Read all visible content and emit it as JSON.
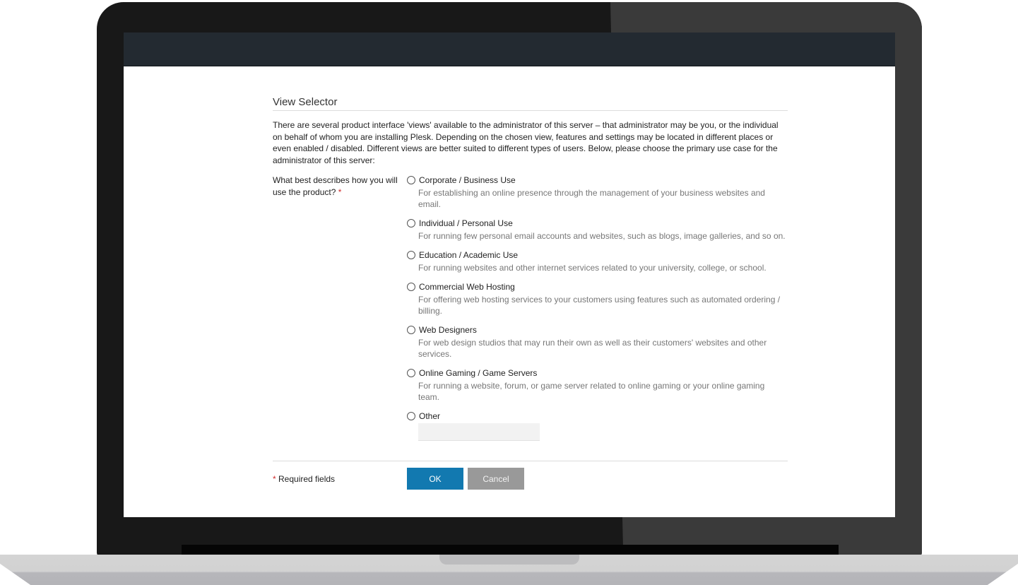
{
  "page": {
    "title": "View Selector",
    "intro": "There are several product interface 'views' available to the administrator of this server – that administrator may be you, or the individual on behalf of whom you are installing Plesk. Depending on the chosen view, features and settings may be located in different places or even enabled / disabled. Different views are better suited to different types of users. Below, please choose the primary use case for the administrator of this server:"
  },
  "form": {
    "question": "What best describes how you will use the product?",
    "required_marker": "*",
    "options": [
      {
        "label": "Corporate / Business Use",
        "description": "For establishing an online presence through the management of your business websites and email.",
        "selected": false
      },
      {
        "label": "Individual / Personal Use",
        "description": "For running few personal email accounts and websites, such as blogs, image galleries, and so on.",
        "selected": false
      },
      {
        "label": "Education / Academic Use",
        "description": "For running websites and other internet services related to your university, college, or school.",
        "selected": false
      },
      {
        "label": "Commercial Web Hosting",
        "description": "For offering web hosting services to your customers using features such as automated ordering / billing.",
        "selected": false
      },
      {
        "label": "Web Designers",
        "description": "For web design studios that may run their own as well as their customers' websites and other services.",
        "selected": false
      },
      {
        "label": "Online Gaming / Game Servers",
        "description": "For running a website, forum, or game server related to online gaming or your online gaming team.",
        "selected": false
      },
      {
        "label": "Other",
        "description": "",
        "selected": false
      }
    ],
    "other_input": {
      "value": "",
      "placeholder": ""
    }
  },
  "footer": {
    "required_marker": "*",
    "required_note": "Required fields",
    "ok_label": "OK",
    "cancel_label": "Cancel"
  },
  "colors": {
    "topbar": "#232a31",
    "primary_button": "#1279b0",
    "secondary_button": "#999999",
    "required_asterisk": "#d02c2c"
  }
}
